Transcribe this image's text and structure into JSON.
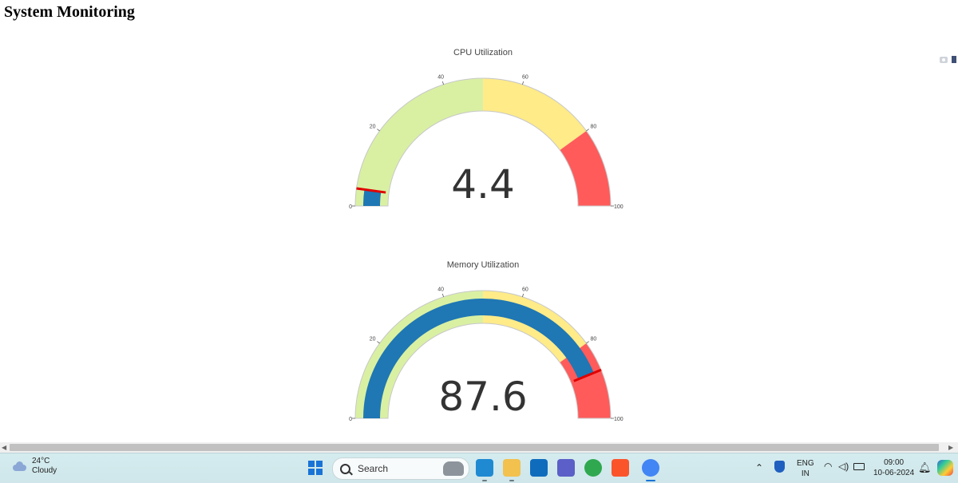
{
  "page": {
    "title": "System Monitoring"
  },
  "gauges": [
    {
      "id": "cpu",
      "title": "CPU Utilization",
      "value": 4.4,
      "value_text": "4.4",
      "range": [
        0,
        100
      ],
      "ticks": [
        0,
        20,
        40,
        60,
        80,
        100
      ],
      "bands": [
        {
          "from": 0,
          "to": 50,
          "color": "#d9f0a3"
        },
        {
          "from": 50,
          "to": 80,
          "color": "#ffeb88"
        },
        {
          "from": 80,
          "to": 100,
          "color": "#ff5b5b"
        }
      ],
      "bar_color": "#1f77b4",
      "threshold": 4.4,
      "threshold_color": "#e00000"
    },
    {
      "id": "memory",
      "title": "Memory Utilization",
      "value": 87.6,
      "value_text": "87.6",
      "range": [
        0,
        100
      ],
      "ticks": [
        0,
        20,
        40,
        60,
        80,
        100
      ],
      "bands": [
        {
          "from": 0,
          "to": 50,
          "color": "#d9f0a3"
        },
        {
          "from": 50,
          "to": 80,
          "color": "#ffeb88"
        },
        {
          "from": 80,
          "to": 100,
          "color": "#ff5b5b"
        }
      ],
      "bar_color": "#1f77b4",
      "threshold": 87.6,
      "threshold_color": "#e00000"
    }
  ],
  "taskbar": {
    "weather": {
      "temp": "24°C",
      "condition": "Cloudy"
    },
    "search": {
      "label": "Search"
    },
    "apps": [
      {
        "name": "vscode-icon",
        "color": "#1f8ad2"
      },
      {
        "name": "file-explorer-icon",
        "color": "#f2c14e"
      },
      {
        "name": "outlook-icon",
        "color": "#0f6cbd"
      },
      {
        "name": "teams-icon",
        "color": "#5b5fc7"
      },
      {
        "name": "chrome-icon",
        "color": "#2fa84f"
      },
      {
        "name": "brave-icon",
        "color": "#fb542b"
      },
      {
        "name": "chrome-profile-icon",
        "color": "#4285f4"
      }
    ],
    "language": {
      "line1": "ENG",
      "line2": "IN"
    },
    "clock": {
      "time": "09:00",
      "date": "10-06-2024"
    }
  }
}
